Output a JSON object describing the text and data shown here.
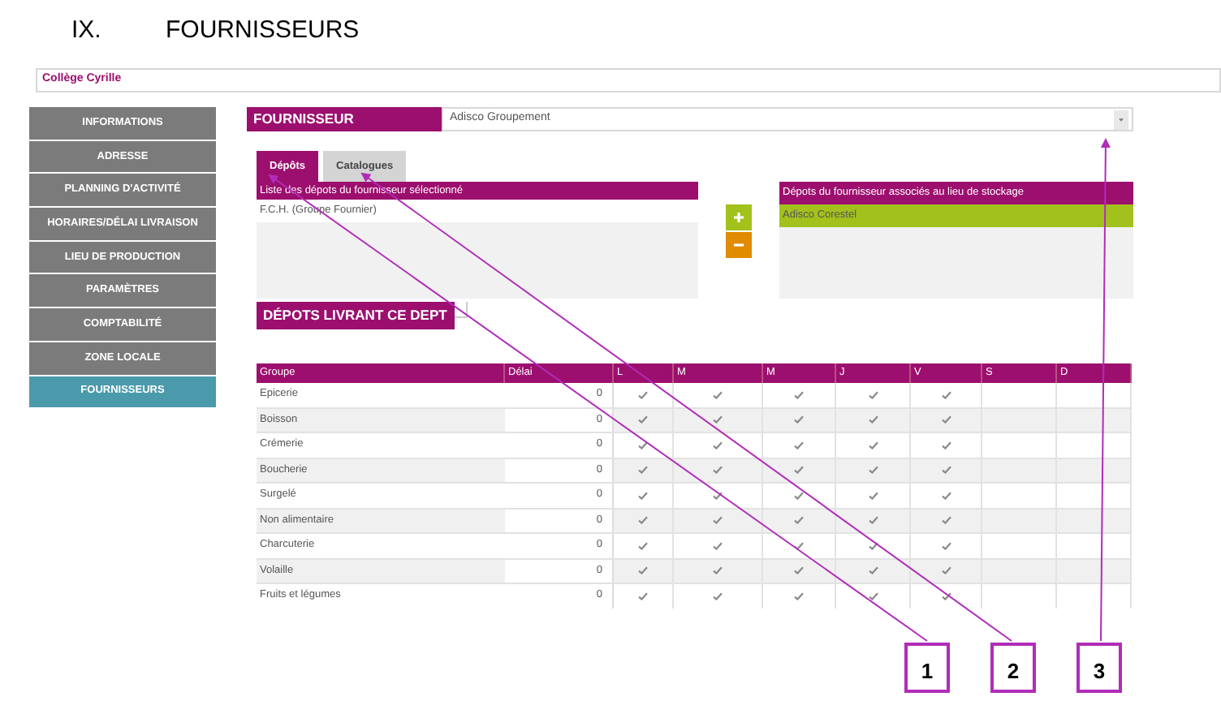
{
  "heading": {
    "number": "IX.",
    "title": "FOURNISSEURS"
  },
  "school": "Collège Cyrille",
  "sidebar": {
    "items": [
      {
        "label": "INFORMATIONS",
        "selected": false
      },
      {
        "label": "ADRESSE",
        "selected": false
      },
      {
        "label": "PLANNING D'ACTIVITÉ",
        "selected": false
      },
      {
        "label": "HORAIRES/DÉLAI LIVRAISON",
        "selected": false
      },
      {
        "label": "LIEU DE PRODUCTION",
        "selected": false
      },
      {
        "label": "PARAMÈTRES",
        "selected": false
      },
      {
        "label": "COMPTABILITÉ",
        "selected": false
      },
      {
        "label": "ZONE LOCALE",
        "selected": false
      },
      {
        "label": "FOURNISSEURS",
        "selected": true
      }
    ]
  },
  "supplier": {
    "label": "FOURNISSEUR",
    "value": "Adisco Groupement"
  },
  "tabs": [
    {
      "label": "Dépôts",
      "selected": true
    },
    {
      "label": "Catalogues",
      "selected": false
    }
  ],
  "available_depots": {
    "title": "Liste des dépots du fournisseur sélectionné",
    "items": [
      {
        "label": "F.C.H. (Groupe Fournier)",
        "selected": false
      }
    ]
  },
  "associated_depots": {
    "title": "Dépots du fournisseur associés au lieu de stockage",
    "items": [
      {
        "label": "Adisco Corestel",
        "selected": true
      }
    ]
  },
  "section_title": "DÉPOTS LIVRANT CE DEPT",
  "table": {
    "columns": [
      "Groupe",
      "Délai",
      "L",
      "M",
      "M",
      "J",
      "V",
      "S",
      "D"
    ],
    "rows": [
      {
        "group": "Epicerie",
        "delay": "0",
        "days": [
          true,
          true,
          true,
          true,
          true,
          false,
          false
        ]
      },
      {
        "group": "Boisson",
        "delay": "0",
        "days": [
          true,
          true,
          true,
          true,
          true,
          false,
          false
        ]
      },
      {
        "group": "Crémerie",
        "delay": "0",
        "days": [
          true,
          true,
          true,
          true,
          true,
          false,
          false
        ]
      },
      {
        "group": "Boucherie",
        "delay": "0",
        "days": [
          true,
          true,
          true,
          true,
          true,
          false,
          false
        ]
      },
      {
        "group": "Surgelé",
        "delay": "0",
        "days": [
          true,
          true,
          true,
          true,
          true,
          false,
          false
        ]
      },
      {
        "group": "Non alimentaire",
        "delay": "0",
        "days": [
          true,
          true,
          true,
          true,
          true,
          false,
          false
        ]
      },
      {
        "group": "Charcuterie",
        "delay": "0",
        "days": [
          true,
          true,
          true,
          true,
          true,
          false,
          false
        ]
      },
      {
        "group": "Volaille",
        "delay": "0",
        "days": [
          true,
          true,
          true,
          true,
          true,
          false,
          false
        ]
      },
      {
        "group": "Fruits et légumes",
        "delay": "0",
        "days": [
          true,
          true,
          true,
          true,
          true,
          false,
          false
        ]
      }
    ]
  },
  "callouts": [
    {
      "label": "1"
    },
    {
      "label": "2"
    },
    {
      "label": "3"
    }
  ]
}
